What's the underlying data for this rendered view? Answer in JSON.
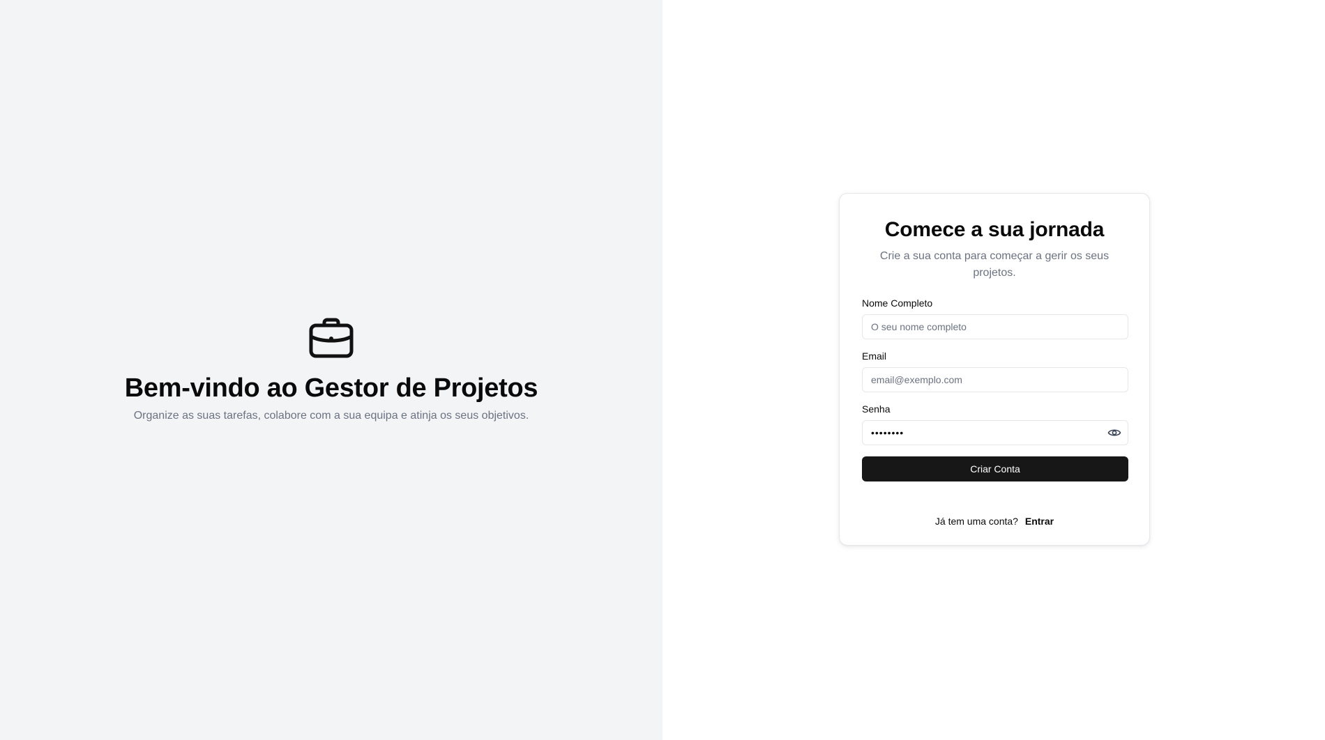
{
  "welcome": {
    "icon": "briefcase-icon",
    "title": "Bem-vindo ao Gestor de Projetos",
    "subtitle": "Organize as suas tarefas, colabore com a sua equipa e atinja os seus objetivos."
  },
  "signup": {
    "title": "Comece a sua jornada",
    "subtitle": "Crie a sua conta para começar a gerir os seus projetos.",
    "full_name": {
      "label": "Nome Completo",
      "placeholder": "O seu nome completo",
      "value": ""
    },
    "email": {
      "label": "Email",
      "placeholder": "email@exemplo.com",
      "value": ""
    },
    "password": {
      "label": "Senha",
      "value": "password",
      "toggle_icon": "eye-icon"
    },
    "submit_label": "Criar Conta",
    "have_account_text": "Já tem uma conta?",
    "login_link": "Entrar"
  },
  "colors": {
    "left_background": "#f3f4f6",
    "right_background": "#ffffff",
    "primary_button": "#171717",
    "muted_text": "#6b7280",
    "border": "#e5e7eb"
  }
}
